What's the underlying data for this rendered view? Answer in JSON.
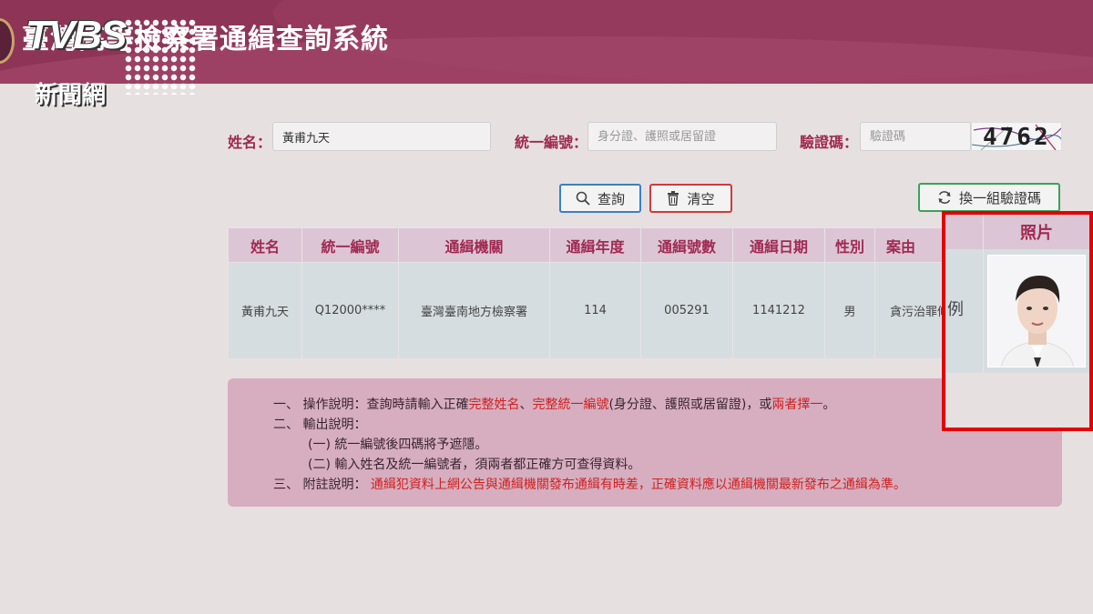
{
  "header": {
    "title": "臺灣高等檢察署通緝查詢系統",
    "watermark_brand": "TVBS",
    "watermark_sub": "新聞網"
  },
  "form": {
    "name_label": "姓名：",
    "name_value": "黃甫九天",
    "id_label": "統一編號：",
    "id_placeholder": "身分證、護照或居留證",
    "captcha_label": "驗證碼：",
    "captcha_placeholder": "驗證碼",
    "captcha_code": "4762"
  },
  "buttons": {
    "query": "查詢",
    "clear": "清空",
    "refresh": "換一組驗證碼"
  },
  "table": {
    "headers": [
      "姓名",
      "統一編號",
      "通緝機關",
      "通緝年度",
      "通緝號數",
      "通緝日期",
      "性別",
      "案由",
      "照片"
    ],
    "row": [
      "黃甫九天",
      "Q12000****",
      "臺灣臺南地方檢察署",
      "114",
      "005291",
      "1141212",
      "男",
      "貪污治罪條",
      "例"
    ]
  },
  "notes": {
    "l1_num": "一、",
    "l1_label": "操作說明：",
    "l1_a": "查詢時請輸入正確",
    "l1_b": "完整姓名",
    "l1_c": "、",
    "l1_d": "完整統一編號",
    "l1_e": "(身分證、護照或居留證)，或",
    "l1_f": "兩者擇一",
    "l1_g": "。",
    "l2_num": "二、",
    "l2_label": "輸出說明：",
    "l3": "(一) 統一編號後四碼將予遮隱。",
    "l4": "(二) 輸入姓名及統一編號者，須兩者都正確方可查得資料。",
    "l5_num": "三、",
    "l5_label": "附註說明：",
    "l5_text": "通緝犯資料上網公告與通緝機關發布通緝有時差，正確資料應以通緝機關最新發布之通緝為準。"
  },
  "colors": {
    "header_bg": "#8e3557",
    "label_red": "#9e2a4f",
    "highlight_box": "#e30000",
    "notes_bg": "#d6aebf"
  },
  "icons": {
    "query": "search-icon",
    "clear": "trash-icon",
    "refresh": "refresh-icon"
  }
}
